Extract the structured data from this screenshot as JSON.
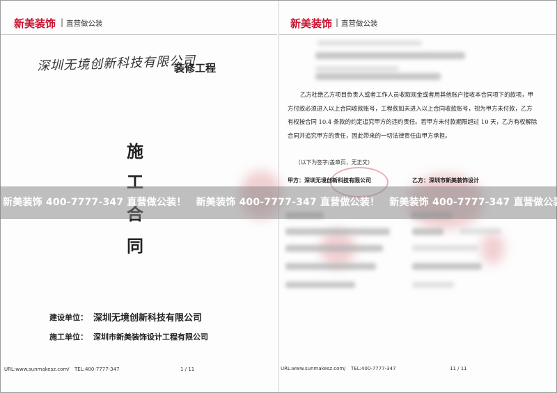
{
  "left_page": {
    "brand": "新美装饰",
    "separator": "|",
    "brand_sub": "直营做公装",
    "client_handwritten": "深圳无境创新科技有限公司",
    "project_suffix": "装修工程",
    "title_chars": [
      "施",
      "工",
      "合",
      "同"
    ],
    "party_a_label": "建设单位：",
    "party_a_name": "深圳无境创新科技有限公司",
    "party_b_label": "施工单位：",
    "party_b_name": "深圳市新美装饰设计工程有限公司",
    "footer_url": "URL:www.sunmakesz.com",
    "footer_slash": "/",
    "footer_tel": "TEL:400-7777-347",
    "page_number": "1 / 11"
  },
  "right_page": {
    "brand": "新美装饰",
    "separator": "|",
    "brand_sub": "直营做公装",
    "paragraph": "乙方杜绝乙方项目负责人或者工作人员收取现金或者用其他账户接收本合同项下的款项，甲方付款必须进入以上合同收款账号，工程款如未进入以上合同收款账号，视为甲方未付款，乙方有权按合同 10.4 条款的约定追究甲方的违约责任。若甲方未付款期限超过 10 天，乙方有权解除合同并追究甲方的责任，因此带来的一切法律责任由甲方承担。",
    "note": "（以下为签字/盖章页，无正文）",
    "party_a": "甲方：深圳无境创新科技有限公司",
    "party_b": "乙方：深圳市新美装饰设计",
    "footer_url": "URL:www.sunmakesz.com",
    "footer_slash": "/",
    "footer_tel": "TEL:400-7777-347",
    "page_number": "11 / 11"
  },
  "watermark": {
    "items": [
      "新美装饰 400-7777-347 直营做公装！",
      "新美装饰 400-7777-347 直营做公装！",
      "新美装饰 400-7777-347 直营做公装！"
    ]
  },
  "colors": {
    "brand_red": "#c8102e",
    "watermark_band": "#828282",
    "stamp": "#d2505c"
  }
}
